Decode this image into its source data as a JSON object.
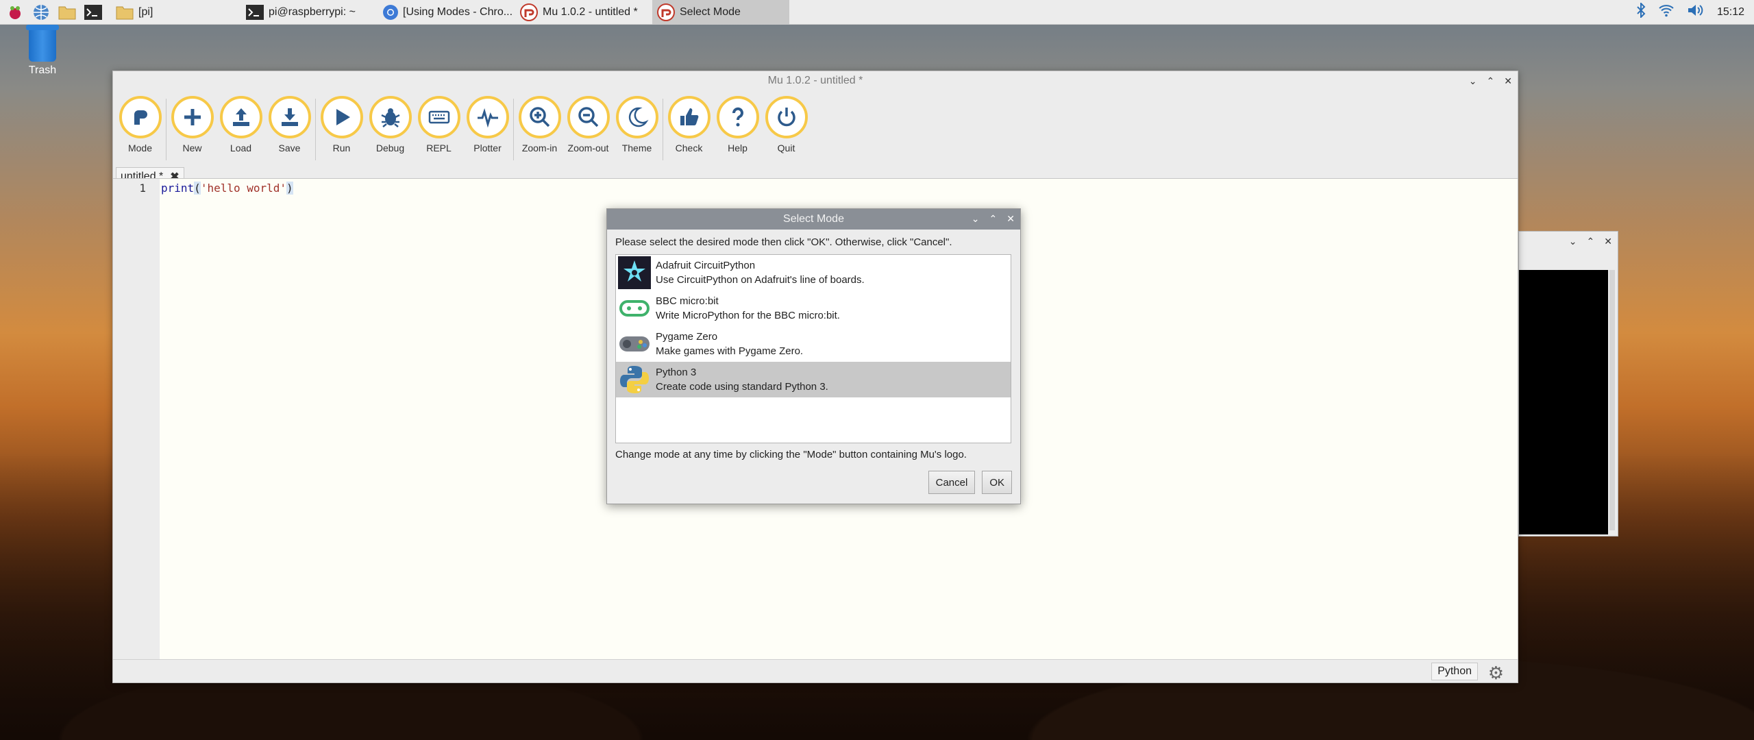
{
  "taskbar": {
    "tasks": [
      {
        "label": "[pi]"
      },
      {
        "label": "pi@raspberrypi: ~"
      },
      {
        "label": "[Using Modes - Chro..."
      },
      {
        "label": "Mu 1.0.2 - untitled *"
      },
      {
        "label": "Select Mode"
      }
    ],
    "clock": "15:12"
  },
  "desktop": {
    "trash_label": "Trash"
  },
  "mu": {
    "title": "Mu 1.0.2 - untitled *",
    "toolbar": {
      "mode": "Mode",
      "new": "New",
      "load": "Load",
      "save": "Save",
      "run": "Run",
      "debug": "Debug",
      "repl": "REPL",
      "plotter": "Plotter",
      "zoom_in": "Zoom-in",
      "zoom_out": "Zoom-out",
      "theme": "Theme",
      "check": "Check",
      "help": "Help",
      "quit": "Quit"
    },
    "tab_label": "untitled *",
    "line_number": "1",
    "code": {
      "fn": "print",
      "open": "(",
      "str": "'hello world'",
      "close": ")"
    },
    "status_mode": "Python"
  },
  "dialog": {
    "title": "Select Mode",
    "prompt": "Please select the desired mode then click \"OK\". Otherwise, click \"Cancel\".",
    "modes": [
      {
        "name": "Adafruit CircuitPython",
        "desc": "Use CircuitPython on Adafruit's line of boards.",
        "icon": "circuitpython-icon"
      },
      {
        "name": "BBC micro:bit",
        "desc": "Write MicroPython for the BBC micro:bit.",
        "icon": "microbit-icon"
      },
      {
        "name": "Pygame Zero",
        "desc": "Make games with Pygame Zero.",
        "icon": "gamepad-icon"
      },
      {
        "name": "Python 3",
        "desc": "Create code using standard Python 3.",
        "icon": "python-icon"
      }
    ],
    "selected_mode": "Python 3",
    "footnote": "Change mode at any time by clicking the \"Mode\" button containing Mu's logo.",
    "cancel_label": "Cancel",
    "ok_label": "OK"
  },
  "colors": {
    "accent": "#f7c948",
    "icon_blue": "#2d5a8c",
    "selection": "#c8c8c8"
  }
}
